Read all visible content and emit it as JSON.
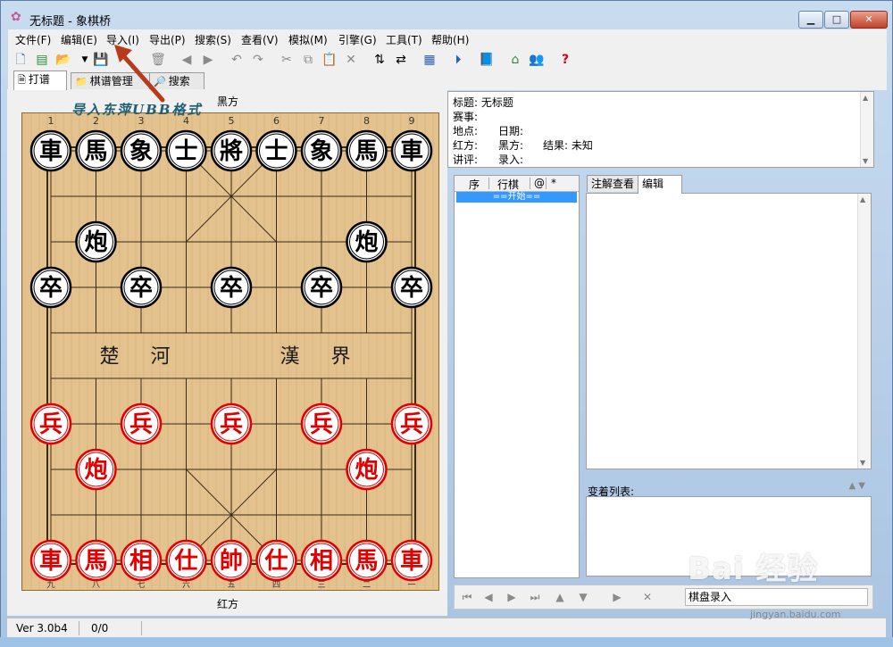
{
  "window": {
    "title": "无标题 - 象棋桥",
    "minimize_glyph": "▁",
    "maximize_glyph": "□",
    "close_glyph": "✕"
  },
  "menu": [
    "文件(F)",
    "编辑(E)",
    "导入(I)",
    "导出(P)",
    "搜索(S)",
    "查看(V)",
    "模拟(M)",
    "引擎(G)",
    "工具(T)",
    "帮助(H)"
  ],
  "tabs": [
    {
      "label": "打谱",
      "icon": "document-icon"
    },
    {
      "label": "棋谱管理",
      "icon": "folder-icon"
    },
    {
      "label": "搜索",
      "icon": "search-icon"
    }
  ],
  "board": {
    "top_side_label": "黑方",
    "bottom_side_label": "红方",
    "top_file_numbers": [
      "1",
      "2",
      "3",
      "4",
      "5",
      "6",
      "7",
      "8",
      "9"
    ],
    "bottom_file_numbers": [
      "九",
      "八",
      "七",
      "六",
      "五",
      "四",
      "三",
      "二",
      "一"
    ],
    "river_left": "楚 河",
    "river_right": "漢 界",
    "annotation": "导入东萍UBB格式",
    "black_color": "#000000",
    "red_color": "#e00000",
    "black_pieces": [
      {
        "char": "車",
        "file": 1,
        "rank": 1
      },
      {
        "char": "馬",
        "file": 2,
        "rank": 1
      },
      {
        "char": "象",
        "file": 3,
        "rank": 1
      },
      {
        "char": "士",
        "file": 4,
        "rank": 1
      },
      {
        "char": "將",
        "file": 5,
        "rank": 1
      },
      {
        "char": "士",
        "file": 6,
        "rank": 1
      },
      {
        "char": "象",
        "file": 7,
        "rank": 1
      },
      {
        "char": "馬",
        "file": 8,
        "rank": 1
      },
      {
        "char": "車",
        "file": 9,
        "rank": 1
      },
      {
        "char": "炮",
        "file": 2,
        "rank": 3
      },
      {
        "char": "炮",
        "file": 8,
        "rank": 3
      },
      {
        "char": "卒",
        "file": 1,
        "rank": 4
      },
      {
        "char": "卒",
        "file": 3,
        "rank": 4
      },
      {
        "char": "卒",
        "file": 5,
        "rank": 4
      },
      {
        "char": "卒",
        "file": 7,
        "rank": 4
      },
      {
        "char": "卒",
        "file": 9,
        "rank": 4
      }
    ],
    "red_pieces": [
      {
        "char": "兵",
        "file": 1,
        "rank": 7
      },
      {
        "char": "兵",
        "file": 3,
        "rank": 7
      },
      {
        "char": "兵",
        "file": 5,
        "rank": 7
      },
      {
        "char": "兵",
        "file": 7,
        "rank": 7
      },
      {
        "char": "兵",
        "file": 9,
        "rank": 7
      },
      {
        "char": "炮",
        "file": 2,
        "rank": 8
      },
      {
        "char": "炮",
        "file": 8,
        "rank": 8
      },
      {
        "char": "車",
        "file": 1,
        "rank": 10
      },
      {
        "char": "馬",
        "file": 2,
        "rank": 10
      },
      {
        "char": "相",
        "file": 3,
        "rank": 10
      },
      {
        "char": "仕",
        "file": 4,
        "rank": 10
      },
      {
        "char": "帥",
        "file": 5,
        "rank": 10
      },
      {
        "char": "仕",
        "file": 6,
        "rank": 10
      },
      {
        "char": "相",
        "file": 7,
        "rank": 10
      },
      {
        "char": "馬",
        "file": 8,
        "rank": 10
      },
      {
        "char": "車",
        "file": 9,
        "rank": 10
      }
    ]
  },
  "info": {
    "title_line": "标题: 无标题",
    "event_line": "赛事:",
    "place_label": "地点:",
    "date_label": "日期:",
    "red_label": "红方:",
    "black_label": "黑方:",
    "result_label": "结果: 未知",
    "comment_label": "讲评:",
    "entry_label": "录入:"
  },
  "move_list": {
    "headers": [
      "序",
      "行棋",
      "@",
      "*"
    ],
    "selected_row": "==开始=="
  },
  "editor_tabs": [
    "注解查看",
    "编辑"
  ],
  "variation_label": "变着列表:",
  "nav_field_text": "棋盘录入",
  "status": {
    "version": "Ver 3.0b4",
    "counter": "0/0"
  },
  "watermark": {
    "logo": "Bai 经验",
    "url": "jingyan.baidu.com"
  }
}
